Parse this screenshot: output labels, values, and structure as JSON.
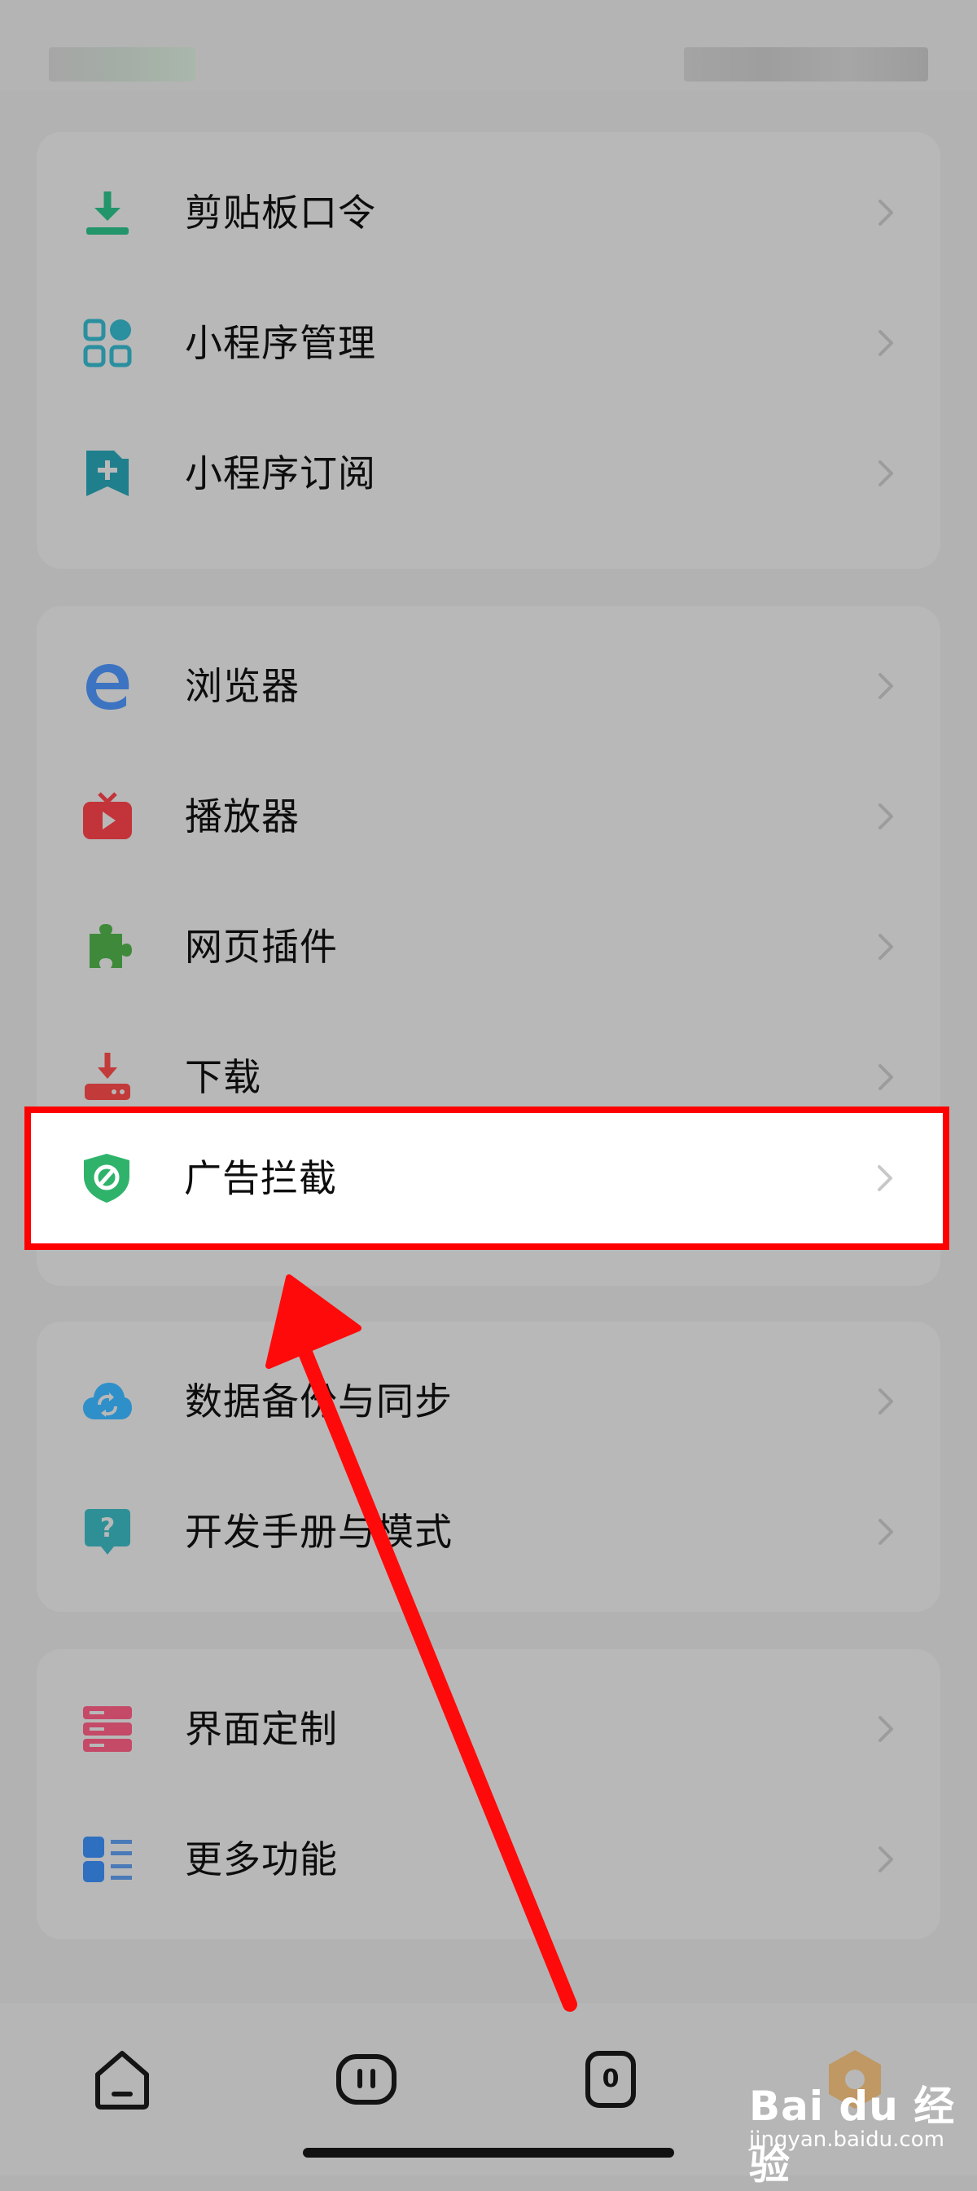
{
  "menu_groups": [
    {
      "items": [
        {
          "label": "剪贴板口令",
          "icon": "clipboard-download-icon"
        },
        {
          "label": "小程序管理",
          "icon": "apps-grid-icon"
        },
        {
          "label": "小程序订阅",
          "icon": "bookmark-plus-icon"
        }
      ]
    },
    {
      "items": [
        {
          "label": "浏览器",
          "icon": "browser-e-icon"
        },
        {
          "label": "播放器",
          "icon": "tv-play-icon"
        },
        {
          "label": "网页插件",
          "icon": "puzzle-icon"
        },
        {
          "label": "下载",
          "icon": "download-icon"
        },
        {
          "label": "广告拦截",
          "icon": "shield-block-icon",
          "highlighted": true
        }
      ]
    },
    {
      "items": [
        {
          "label": "数据备份与同步",
          "icon": "cloud-sync-icon"
        },
        {
          "label": "开发手册与模式",
          "icon": "help-bubble-icon"
        }
      ]
    },
    {
      "items": [
        {
          "label": "界面定制",
          "icon": "layout-custom-icon"
        },
        {
          "label": "更多功能",
          "icon": "more-list-icon"
        }
      ]
    }
  ],
  "bottom_nav": {
    "tabs_count": "0",
    "items": [
      "home-icon",
      "menu-icon",
      "tabs-icon",
      "profile-icon"
    ]
  },
  "watermark": {
    "brand": "Bai du 经验",
    "sub": "jingyan.baidu.com"
  },
  "colors": {
    "highlight_border": "#ff0000",
    "annotation_arrow": "#ff0a0a",
    "overlay_bg": "#b2b2b2"
  }
}
